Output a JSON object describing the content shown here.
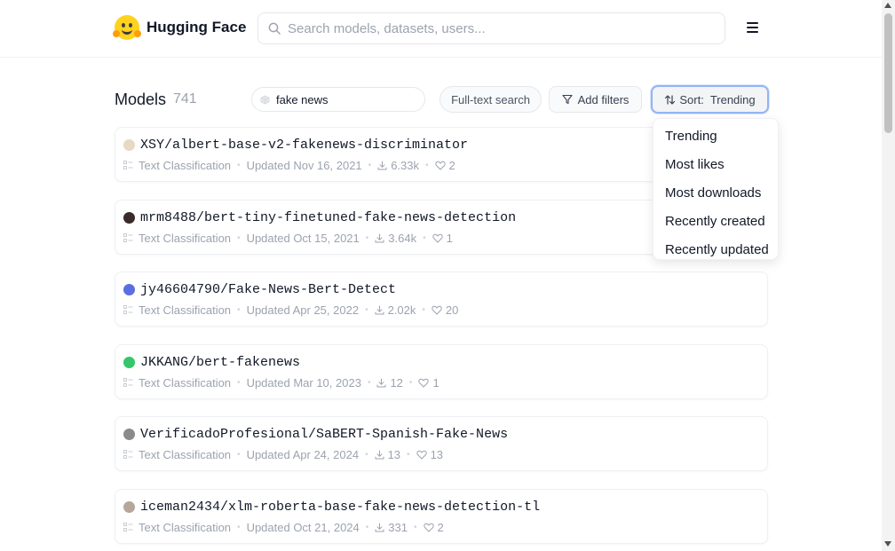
{
  "header": {
    "brand": "Hugging Face",
    "search_placeholder": "Search models, datasets, users..."
  },
  "toolbar": {
    "title": "Models",
    "count": "741",
    "filter_value": "fake news",
    "fulltext_label": "Full-text search",
    "add_filters_label": "Add filters",
    "sort_prefix": "Sort:",
    "sort_value": "Trending"
  },
  "sort_menu": {
    "items": [
      "Trending",
      "Most likes",
      "Most downloads",
      "Recently created",
      "Recently updated"
    ]
  },
  "models": [
    {
      "name": "XSY/albert-base-v2-fakenews-discriminator",
      "task": "Text Classification",
      "updated": "Updated Nov 16, 2021",
      "downloads": "6.33k",
      "likes": "2",
      "avatar_color": "#e8d9c4"
    },
    {
      "name": "mrm8488/bert-tiny-finetuned-fake-news-detection",
      "task": "Text Classification",
      "updated": "Updated Oct 15, 2021",
      "downloads": "3.64k",
      "likes": "1",
      "avatar_color": "#3b2a2a"
    },
    {
      "name": "jy46604790/Fake-News-Bert-Detect",
      "task": "Text Classification",
      "updated": "Updated Apr 25, 2022",
      "downloads": "2.02k",
      "likes": "20",
      "avatar_color": "#5b6ee1"
    },
    {
      "name": "JKKANG/bert-fakenews",
      "task": "Text Classification",
      "updated": "Updated Mar 10, 2023",
      "downloads": "12",
      "likes": "1",
      "avatar_color": "#34c66b"
    },
    {
      "name": "VerificadoProfesional/SaBERT-Spanish-Fake-News",
      "task": "Text Classification",
      "updated": "Updated Apr 24, 2024",
      "downloads": "13",
      "likes": "13",
      "avatar_color": "#8a8a8a"
    },
    {
      "name": "iceman2434/xlm-roberta-base-fake-news-detection-tl",
      "task": "Text Classification",
      "updated": "Updated Oct 21, 2024",
      "downloads": "331",
      "likes": "2",
      "avatar_color": "#b7a79a"
    }
  ],
  "colors": {
    "accent_focus": "#93b4f5",
    "brand_yellow": "#ffd21e",
    "muted_text": "#9ca3af"
  }
}
